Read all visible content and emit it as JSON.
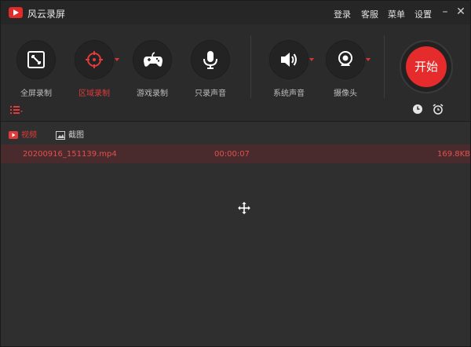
{
  "app": {
    "title": "风云录屏"
  },
  "titlebar": {
    "menu": [
      "登录",
      "客服",
      "菜单",
      "设置"
    ],
    "minimize": "–",
    "close": "✕"
  },
  "toolbar": {
    "tools": [
      {
        "label": "全屏录制",
        "icon": "fullscreen-icon",
        "active": false
      },
      {
        "label": "区域录制",
        "icon": "target-icon",
        "active": true
      },
      {
        "label": "游戏录制",
        "icon": "gamepad-icon",
        "active": false
      },
      {
        "label": "只录声音",
        "icon": "microphone-icon",
        "active": false
      }
    ],
    "sources": [
      {
        "label": "系统声音",
        "icon": "speaker-icon"
      },
      {
        "label": "摄像头",
        "icon": "webcam-icon"
      }
    ],
    "start_label": "开始"
  },
  "tabs": [
    {
      "label": "视频",
      "icon": "video-icon",
      "active": true
    },
    {
      "label": "截图",
      "icon": "screenshot-icon",
      "active": false
    }
  ],
  "files": [
    {
      "name": "20200916_151139.mp4",
      "duration": "00:00:07",
      "size": "169.8KB"
    }
  ],
  "colors": {
    "accent": "#e52b2b",
    "bg": "#2f2f2f"
  }
}
